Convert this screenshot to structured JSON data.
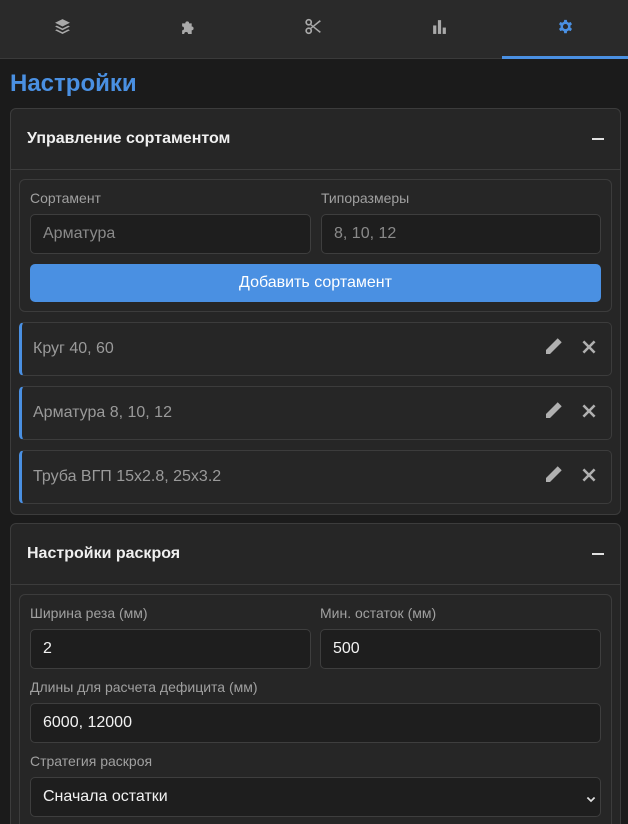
{
  "tabs": [
    {
      "icon": "layers-icon",
      "active": false
    },
    {
      "icon": "puzzle-icon",
      "active": false
    },
    {
      "icon": "scissors-icon",
      "active": false
    },
    {
      "icon": "bar-chart-icon",
      "active": false
    },
    {
      "icon": "gear-icon",
      "active": true
    }
  ],
  "page": {
    "title": "Настройки",
    "accent_color": "#4a90e2"
  },
  "assortment": {
    "title": "Управление сортаментом",
    "name_label": "Сортамент",
    "name_placeholder": "Арматура",
    "sizes_label": "Типоразмеры",
    "sizes_placeholder": "8, 10, 12",
    "add_button": "Добавить сортамент",
    "items": [
      {
        "label": "Круг 40, 60"
      },
      {
        "label": "Арматура 8, 10, 12"
      },
      {
        "label": "Труба ВГП 15х2.8, 25х3.2"
      }
    ]
  },
  "cutting": {
    "title": "Настройки раскроя",
    "kerf_label": "Ширина реза (мм)",
    "kerf_value": "2",
    "min_remnant_label": "Мин. остаток (мм)",
    "min_remnant_value": "500",
    "deficit_lengths_label": "Длины для расчета дефицита (мм)",
    "deficit_lengths_value": "6000, 12000",
    "strategy_label": "Стратегия раскроя",
    "strategy_value": "Сначала остатки"
  }
}
